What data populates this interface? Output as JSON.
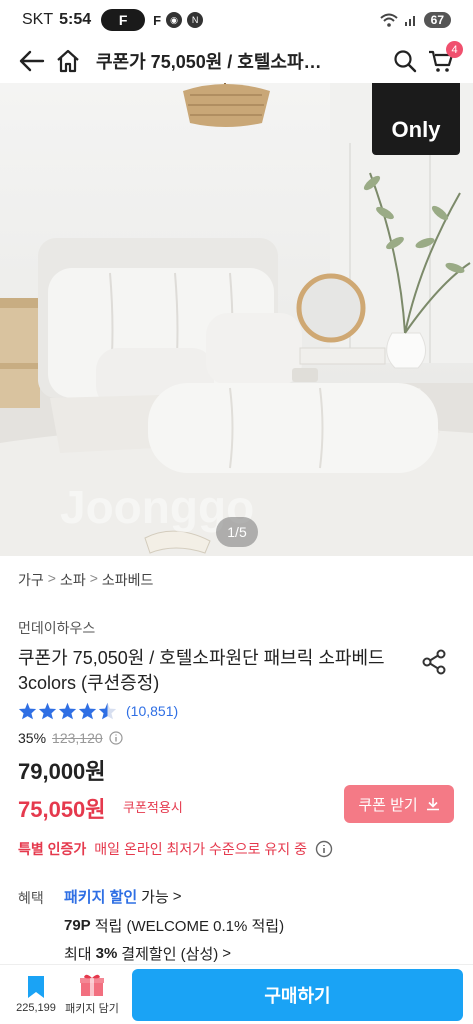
{
  "status_bar": {
    "carrier": "SKT",
    "time": "5:54",
    "badge": "F",
    "battery": "67"
  },
  "header": {
    "title": "쿠폰가 75,050원 / 호텔소파…",
    "cart_count": "4"
  },
  "hero": {
    "tag": "Only",
    "counter": "1/5",
    "watermark": "Joonggo"
  },
  "breadcrumb": [
    "가구",
    "소파",
    "소파베드"
  ],
  "product": {
    "brand": "먼데이하우스",
    "title": "쿠폰가 75,050원 / 호텔소파원단 패브릭 소파베드 3colors (쿠션증정)",
    "rating_value": 4.5,
    "review_count": "(10,851)",
    "discount_rate": "35%",
    "original_price": "123,120",
    "price": "79,000원",
    "coupon_price": "75,050원",
    "coupon_note": "쿠폰적용시",
    "coupon_button": "쿠폰 받기"
  },
  "special": {
    "label": "특별 인증가",
    "text": "매일 온라인 최저가 수준으로 유지 중"
  },
  "benefits": {
    "label": "혜택",
    "package": "패키지 할인",
    "package_suffix": "가능",
    "points": "79P",
    "points_text": "적립 (WELCOME 0.1% 적립)",
    "card_prefix": "최대",
    "card_rate": "3%",
    "card_text": "결제할인 (삼성)"
  },
  "bottom_bar": {
    "bookmark_count": "225,199",
    "package_label": "패키지 담기",
    "buy_label": "구매하기"
  },
  "colors": {
    "accent_blue": "#1aa3f5",
    "sale_red": "#e5394d",
    "coupon_pink": "#f47a86",
    "star_blue": "#2f6fe4"
  }
}
